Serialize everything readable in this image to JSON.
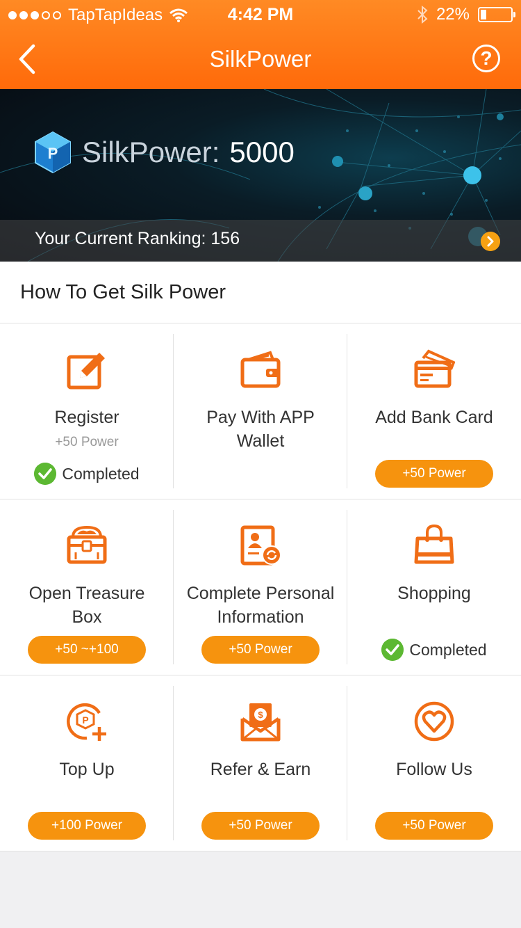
{
  "status_bar": {
    "carrier": "TapTapIdeas",
    "time": "4:42 PM",
    "battery": "22%"
  },
  "nav": {
    "title": "SilkPower",
    "help_label": "?"
  },
  "banner": {
    "silkpower_label": "SilkPower:",
    "silkpower_value": "5000",
    "ranking_text": "Your Current Ranking: 156"
  },
  "section": {
    "title": "How To Get Silk Power"
  },
  "tasks": [
    {
      "title": "Register",
      "sub": "+50 Power",
      "status": "Completed"
    },
    {
      "title": "Pay With APP Wallet"
    },
    {
      "title": "Add Bank Card",
      "button": "+50 Power"
    },
    {
      "title": "Open Treasure Box",
      "button": "+50 ~+100"
    },
    {
      "title": "Complete Personal Information",
      "button": "+50 Power"
    },
    {
      "title": "Shopping",
      "status": "Completed"
    },
    {
      "title": "Top Up",
      "button": "+100 Power"
    },
    {
      "title": "Refer & Earn",
      "button": "+50 Power"
    },
    {
      "title": "Follow Us",
      "button": "+50 Power"
    }
  ],
  "colors": {
    "header_orange": "#ff7a16",
    "accent_orange": "#f6930e",
    "icon_orange": "#f06d16",
    "check_green": "#5cb832"
  }
}
